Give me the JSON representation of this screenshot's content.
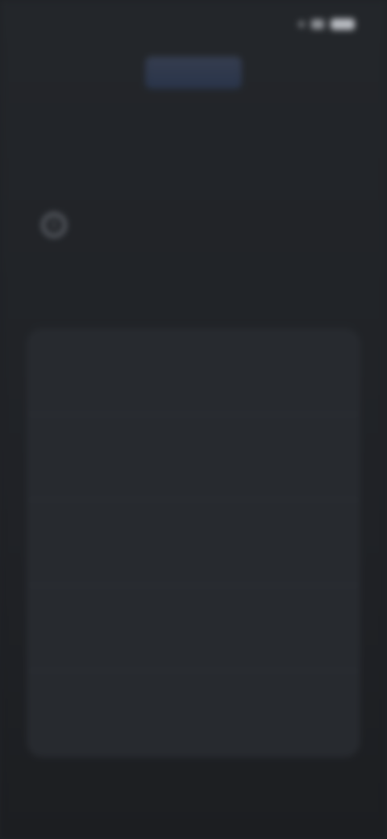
{
  "status_bar": {
    "time": "",
    "icons": [
      "notification-dot",
      "signal-icon",
      "battery-icon"
    ]
  },
  "header": {
    "logo": "app-logo",
    "title": ""
  },
  "notice": {
    "icon": "info-icon",
    "text": ""
  },
  "options": [
    {
      "label": ""
    },
    {
      "label": ""
    },
    {
      "label": ""
    },
    {
      "label": ""
    },
    {
      "label": ""
    }
  ],
  "colors": {
    "background": "#202226",
    "card": "#272a2f",
    "accent": "#2b3852"
  }
}
